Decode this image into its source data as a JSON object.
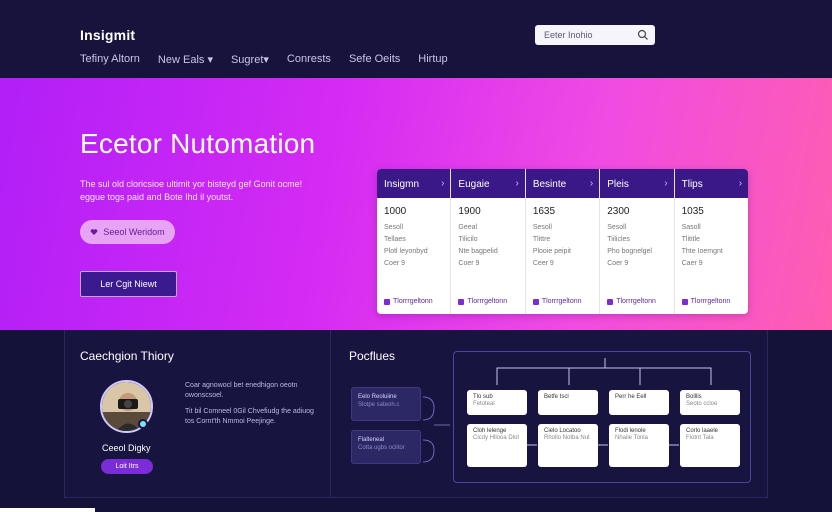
{
  "header": {
    "logo": "Insigmit",
    "search_placeholder": "Eeter Inohio",
    "nav": [
      "Tefiny Altorn",
      "New Eals ▾",
      "Sugret▾",
      "Conrests",
      "Sefe Oeits",
      "Hirtup"
    ],
    "icons": [
      "search-icon",
      "clipboard-icon",
      "settings-icon",
      "refresh-icon"
    ]
  },
  "hero": {
    "title": "Ecetor Nutomation",
    "subtitle": "The sul old cloricsioe ultimit yor bisteyd gef Gonit ocme! eggue togs paid and Bote Ihd il youtst.",
    "pill_label": "Seeol Weridom",
    "cta_label": "Ler Cgit Niewt"
  },
  "pricing": {
    "columns": [
      {
        "name": "Insigmn",
        "price": "1000",
        "lines": [
          "Sesoll",
          "Tellaes",
          "Plotl leyonbyd",
          "Coer 9"
        ],
        "footer": "Tlorrrgeltonn"
      },
      {
        "name": "Eugaie",
        "price": "1900",
        "lines": [
          "Geeal",
          "Tilicilo",
          "Nte bagpelid",
          "Coer 9"
        ],
        "footer": "Tlorrrgeltonn"
      },
      {
        "name": "Besinte",
        "price": "1635",
        "lines": [
          "Sesoll",
          "Tlittre",
          "Plooie peipit",
          "Ceer 9"
        ],
        "footer": "Tlorrrgeltonn"
      },
      {
        "name": "Pleis",
        "price": "2300",
        "lines": [
          "Sesoll",
          "Tiilicles",
          "Pho bognelgel",
          "Coer 9"
        ],
        "footer": "Tlorrrgeltonn"
      },
      {
        "name": "Tlips",
        "price": "1035",
        "lines": [
          "Sasoll",
          "Tlititle",
          "Thte Ioemgnt",
          "Caer 9"
        ],
        "footer": "Tlorrrgeltonn"
      }
    ]
  },
  "testimonial": {
    "title": "Caechgion Thiory",
    "name": "Ceeol Digky",
    "button": "Loit Itrs",
    "desc1": "Coar agnowocl bet enedhigon oeotn owonscsoel.",
    "desc2": "Tit bil Comneel 0Gil Chvefiudg the adiuog tos Cornt'th Nmmoi Peejinge."
  },
  "pipeline": {
    "title": "Pocflues",
    "left_nodes": [
      {
        "title": "Eelo Reoluiine",
        "sub": "Slotpe sateoh.c"
      },
      {
        "title": "Flalteneal",
        "sub": "Cotta ugbs oclitor"
      }
    ],
    "top_boxes": [
      {
        "title": "Tlo sub",
        "sub": "Fetoteal"
      },
      {
        "title": "Betfe tscl",
        "sub": ""
      },
      {
        "title": "Perr he Eell",
        "sub": ""
      },
      {
        "title": "Bolllis",
        "sub": "Seoto ccloe"
      }
    ],
    "bottom_boxes": [
      {
        "title": "Cloh lelenge",
        "sub": "Cicdy Hllooa Dlot"
      },
      {
        "title": "Cielo Locatoo",
        "sub": "Rhollo Notba Nut"
      },
      {
        "title": "Flodi lenole",
        "sub": "Nhaile Tonla"
      },
      {
        "title": "Corlo laaele",
        "sub": "Fiotnt Tala"
      }
    ]
  },
  "colors": {
    "accent": "#b11ff7",
    "navy": "#15123a",
    "header": "#3b1887",
    "pink": "#ff5eb0"
  }
}
